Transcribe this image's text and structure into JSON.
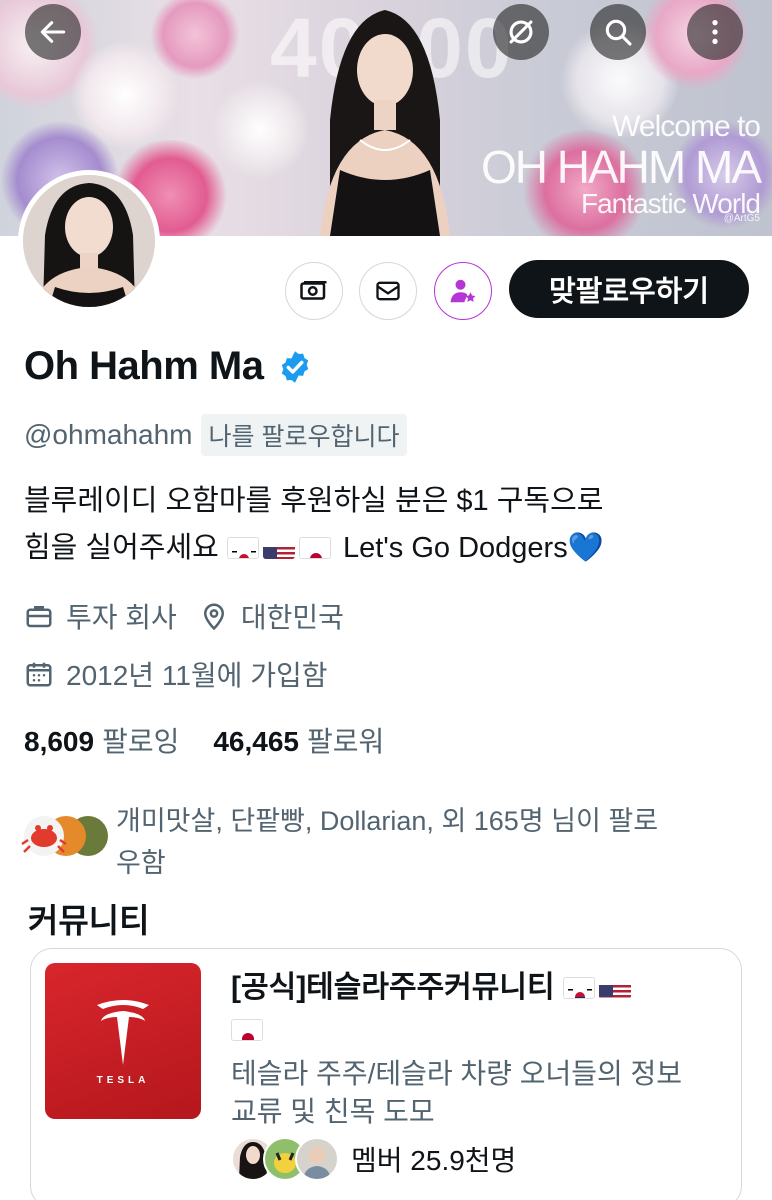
{
  "banner": {
    "big_number": "40000",
    "welcome_line1": "Welcome to",
    "welcome_line2": "OH HAHM MA",
    "welcome_line3": "Fantastic World",
    "credit": "@ArtG5"
  },
  "top_actions": {
    "back_icon": "arrow-left-icon",
    "grok_icon": "slash-circle-icon",
    "search_icon": "search-icon",
    "more_icon": "more-vertical-icon"
  },
  "profile": {
    "name": "Oh Hahm Ma",
    "handle": "@ohmahahm",
    "follows_you": "나를 팔로우합니다",
    "bio_line1": "블루레이디 오함마를 후원하실 분은 $1 구독으로",
    "bio_line2_prefix": "힘을 실어주세요",
    "bio_line2_suffix": " Let's Go Dodgers",
    "bio_heart": "💙",
    "job": "투자 회사",
    "location": "대한민국",
    "joined": "2012년 11월에 가입함",
    "following_count": "8,609",
    "following_label": "팔로잉",
    "followers_count": "46,465",
    "followers_label": "팔로워"
  },
  "actions": {
    "follow_back_label": "맞팔로우하기",
    "subscribe_icon": "money-icon",
    "message_icon": "mail-icon",
    "subscription_icon": "user-star-icon"
  },
  "followed_by": {
    "text": "개미맛살, 단팥빵, Dollarian, 외 165명 님이 팔로우함"
  },
  "community": {
    "heading": "커뮤니티",
    "title": "[공식]테슬라주주커뮤니티",
    "logo_word": "TESLA",
    "description": "테슬라 주주/테슬라 차량 오너들의 정보 교류 및 친목 도모",
    "members": "멤버 25.9천명"
  },
  "colors": {
    "accent": "#1d9bf0",
    "text_primary": "#0f1419",
    "text_secondary": "#536471",
    "border": "#cfd9de",
    "tesla_red": "#c81e24",
    "subscription_purple": "#b535d6"
  }
}
